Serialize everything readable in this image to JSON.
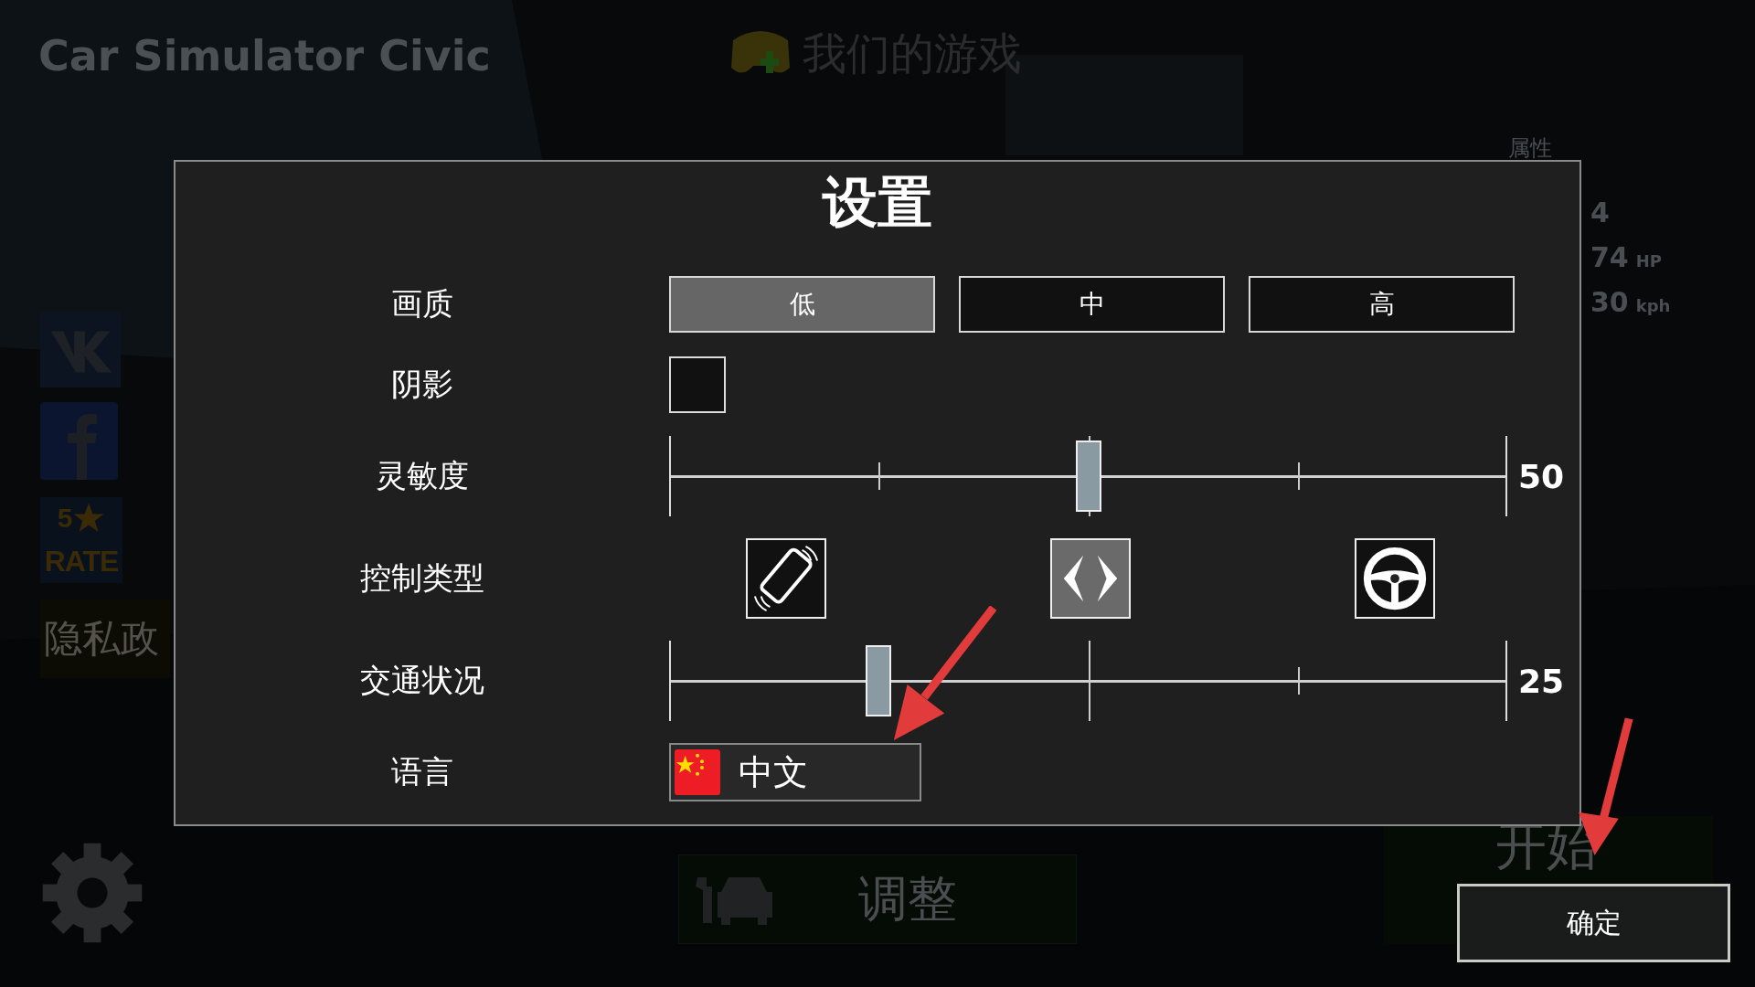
{
  "background": {
    "game_title": "Car Simulator Civic",
    "our_games": "我们的游戏",
    "stats_title": "属性",
    "stats": [
      {
        "value": "4"
      },
      {
        "value": "74",
        "unit": "HP"
      },
      {
        "value": "30",
        "unit": "kph"
      }
    ],
    "rate": {
      "number": "5",
      "label": "RATE"
    },
    "privacy": "隐私政",
    "tune": "调整",
    "start": "开始"
  },
  "settings": {
    "title": "设置",
    "rows": [
      {
        "kind": "choice",
        "label": "画质",
        "options": [
          {
            "label": "低",
            "selected": true
          },
          {
            "label": "中",
            "selected": false
          },
          {
            "label": "高",
            "selected": false
          }
        ]
      },
      {
        "kind": "checkbox",
        "label": "阴影",
        "checked": false
      },
      {
        "kind": "slider",
        "label": "灵敏度",
        "level": 0.5,
        "reading": "50"
      },
      {
        "kind": "control",
        "label": "控制类型",
        "options": [
          {
            "kind": "tilt",
            "selected": false
          },
          {
            "kind": "arrows",
            "selected": true
          },
          {
            "kind": "wheel",
            "selected": false
          }
        ]
      },
      {
        "kind": "slider",
        "label": "交通状况",
        "level": 0.25,
        "reading": "25"
      },
      {
        "kind": "language",
        "label": "语言",
        "value": "中文"
      }
    ]
  },
  "confirm_button": "确定"
}
